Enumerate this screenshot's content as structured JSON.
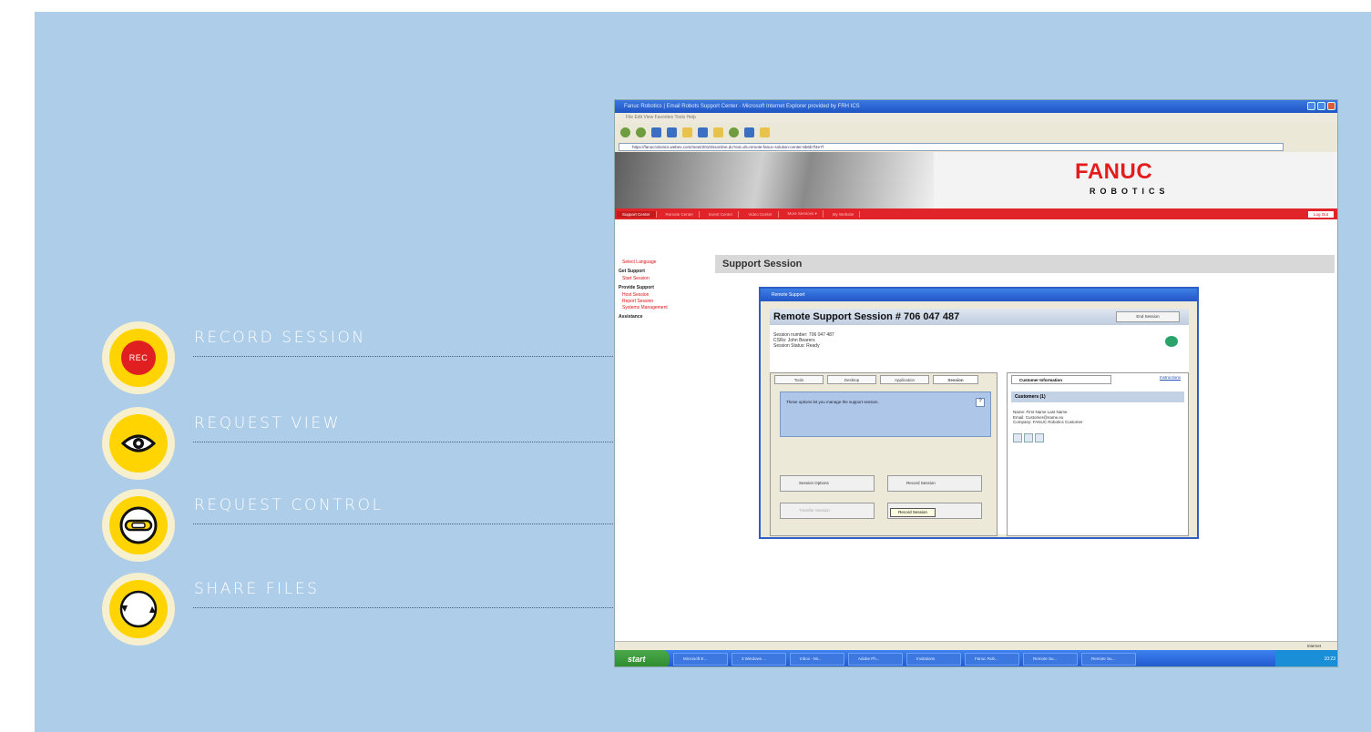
{
  "features": [
    {
      "label": "RECORD SESSION",
      "icon": "rec-icon",
      "badge": "REC"
    },
    {
      "label": "REQUEST VIEW",
      "icon": "eye-icon"
    },
    {
      "label": "REQUEST CONTROL",
      "icon": "steering-wheel-icon"
    },
    {
      "label": "SHARE FILES",
      "icon": "circular-arrows-icon"
    }
  ],
  "browser": {
    "window_title": "Fanuc Robotics | Email Robots Support Center - Microsoft Internet Explorer provided by FRH ICS",
    "menu": "File  Edit  View  Favorites  Tools  Help",
    "address": "https://fanucrobotics.webex.com/meet/2010/ssonline.do?ext=dt=remote-fanuc-solution-center-6b6b7f4e7f"
  },
  "brand": {
    "name": "FANUC",
    "sub": "ROBOTICS",
    "accent": "#e31d1d"
  },
  "nav": {
    "items": [
      "Support Center",
      "Remote Center",
      "Event Center",
      "Video Center",
      "More Services ▾",
      "My Website"
    ],
    "login": "Log Out"
  },
  "sidebar": {
    "select_language": "Select Language",
    "get_support": "Get Support",
    "start_session": "Start Session",
    "provide_support": "Provide Support",
    "host_session": "Host Session",
    "report_session": "Report Session",
    "systems_management": "Systems Management",
    "assistance": "Assistance"
  },
  "page": {
    "section_title": "Support Session"
  },
  "dialog": {
    "title": "Remote Support",
    "session_heading": "Remote Support Session # 706 047 487",
    "end_session": "End Session",
    "session_number": "Session number: 706 047 487",
    "csr": "CSRs: John Bearers",
    "status": "Session Status: Ready",
    "tabs": [
      "Tools",
      "Desktop",
      "Application",
      "Session"
    ],
    "panel_text": "These options let you manage the support session.",
    "help": "?",
    "btn_session_options": "Session Options",
    "btn_record_session": "Record Session",
    "btn_transfer_session": "Transfer Session",
    "btn_end_session": "End Session",
    "tooltip": "Record Session",
    "cust_tab": "Customer Information",
    "instructions": "Instructions",
    "customers": "Customers (1)",
    "cust_name": "Name: First Name Last Name",
    "cust_email": "Email: Customer@name.eu",
    "cust_company": "Company: FANUC Robotics Customer"
  },
  "status_bar": "Internet",
  "taskbar": {
    "start": "start",
    "tasks": [
      "Microsoft E...",
      "3 Windows ...",
      "Inbox - Mi...",
      "Adobe Ph...",
      "Invitations",
      "Fanuc Rob...",
      "Remote Su...",
      "Remote Su..."
    ],
    "clock": "10:23"
  }
}
